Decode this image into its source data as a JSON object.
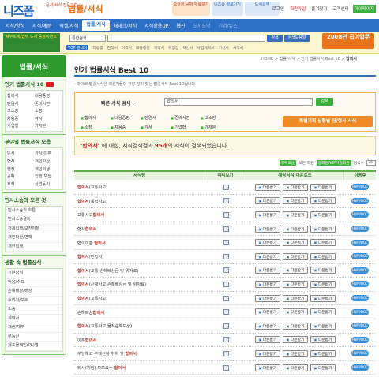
{
  "header": {
    "logo": "니즈폼",
    "logo_sub": "문서/서식 전문기업",
    "category": "법률/서식",
    "promo1": "오늘의 공짜 무료보기",
    "promo2": "니즈폼 바로가기",
    "promo3": "도서요약",
    "top_links": [
      "로그인",
      "회원가입",
      "즐겨찾기",
      "고객센터",
      "마이페이지"
    ]
  },
  "nav": {
    "items": [
      "서식/양식",
      "서식/예문",
      "엑셀/서식",
      "법률/서식",
      "재테크/서식",
      "서식활용UP",
      "웹진",
      "도서요약",
      "기업/뉴스"
    ],
    "active_index": 3
  },
  "topbar": {
    "banner": "세무회계/법무 도서 증정이벤트",
    "search_select": "통합검색",
    "search_button": "검색",
    "adv_button": "검색도움말",
    "promo": "2008년 급여업무",
    "top_search_label": "TOP 검색어",
    "top_search": [
      "차용증",
      "견적서",
      "이력서",
      "내용증명",
      "계약서",
      "위임장",
      "확인서",
      "사업계획서",
      "기안서",
      "사직서"
    ]
  },
  "sidebar": {
    "title": "법률/서식",
    "section1": {
      "title": "인기 법률서식 10",
      "items": [
        "합의서",
        "내용증명",
        "탄원서",
        "준비서면",
        "고소장",
        "소장",
        "차용증",
        "각서",
        "기업형",
        "가처분"
      ]
    },
    "section2": {
      "title": "분야별 법률서식 모음",
      "items": [
        "민사",
        "가사/이혼",
        "형사",
        "개인파산",
        "행정",
        "개인회생",
        "공탁",
        "집행/보전",
        "호적",
        "상업등기"
      ]
    },
    "section3": {
      "title": "민사소송의 모든 것",
      "items": [
        "민사소송의 흐름",
        "민사소송절차",
        "강제집행/보전처분",
        "개인파산/면책",
        "개인회생"
      ]
    },
    "section4": {
      "title": "생활 속 법률상식",
      "items": [
        "기본상식",
        "어음/수표",
        "손해배상/배상",
        "소비자/보호",
        "소송",
        "계약서",
        "채권/채무",
        "부동산",
        "제조물책임(PL)법"
      ]
    }
  },
  "content": {
    "breadcrumb": "HOME > 법률/서식 > 인기 법률서식 Best 10 >",
    "breadcrumb_current": "합의서",
    "title": "인기 법률서식 Best 10",
    "description": "- 마이크 법률서식은 이용자들이 가장 많이 찾는 법률서식 Best 10입니다.",
    "search_label": "빠른 서식 검색 :",
    "search_value": "합의서",
    "search_button": "검색",
    "categories": [
      "합의서",
      "내용증명",
      "탄원서",
      "준비서면",
      "고소장",
      "소장",
      "차용증",
      "각서",
      "기업형",
      "가처분"
    ],
    "special_button": "특별기획 상황별 민/형사 서식",
    "result_pre": "\"",
    "result_keyword": "합의서",
    "result_mid": "\" 에 대한, 서식검색결과 ",
    "result_count": "95개",
    "result_post": "의 서식이 검색되었습니다.",
    "sort_label": "정확도순",
    "sort_items": [
      "모든 회원",
      "정회원/VIP기업회원",
      "검색수"
    ],
    "page_size": "30",
    "columns": [
      "서식명",
      "미리보기",
      "해당서식 다운로드",
      "이용후"
    ],
    "download_label": "다운받기",
    "tag_label": "HWP/DOC",
    "rows": [
      {
        "pre": "",
        "hl": "합의서",
        "post": "(교통사고)"
      },
      {
        "pre": "",
        "hl": "합의서",
        "post": "(폭력사고)"
      },
      {
        "pre": "교통사고",
        "hl": "합의서",
        "post": ""
      },
      {
        "pre": "형사",
        "hl": "합의서",
        "post": ""
      },
      {
        "pre": "협의이혼 ",
        "hl": "합의서",
        "post": ""
      },
      {
        "pre": "",
        "hl": "합의서",
        "post": "(민형사)"
      },
      {
        "pre": "",
        "hl": "합의서",
        "post": "(교통 손해배상금 및 위자료)"
      },
      {
        "pre": "",
        "hl": "합의서",
        "post": "(산재사고 손해배상금 및 위자료)"
      },
      {
        "pre": "",
        "hl": "합의서",
        "post": "(교통사고)"
      },
      {
        "pre": "손해배상",
        "hl": "합의서",
        "post": ""
      },
      {
        "pre": "",
        "hl": "합의서",
        "post": "(교통사고 물적손해보상)"
      },
      {
        "pre": "이혼",
        "hl": "합의서",
        "post": ""
      },
      {
        "pre": "부당해고 구제신청 취하 및 ",
        "hl": "합의서",
        "post": ""
      },
      {
        "pre": "퇴사(위임) 모보요수 ",
        "hl": "합의서",
        "post": ""
      }
    ]
  },
  "colors": {
    "nav": "#2d6fc4",
    "green": "#2d9b2d",
    "accent": "#d21b1b",
    "orange": "#f08a24"
  }
}
